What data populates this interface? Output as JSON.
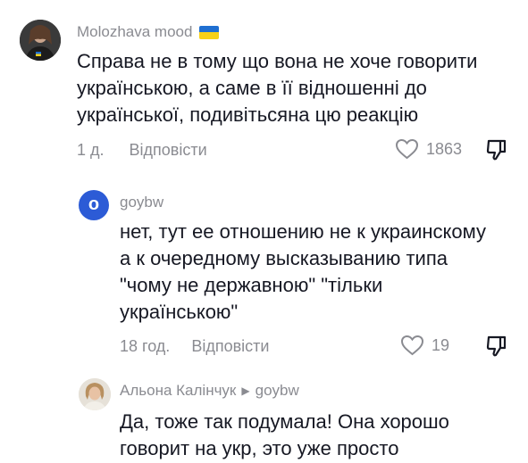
{
  "comments": [
    {
      "username": "Molozhava mood",
      "text": "Справа не в тому що вона не хоче говорити українською, а саме в її відношенні до української, подивітьсяна цю реакцію",
      "time": "1 д.",
      "reply_label": "Відповісти",
      "likes": "1863"
    },
    {
      "username": "goybw",
      "avatar_letter": "o",
      "text": "нет, тут ее отношению не к украинскому а к очередному высказыванию типа \"чому не державною\" \"тільки українською\"",
      "time": "18 год.",
      "reply_label": "Відповісти",
      "likes": "19"
    },
    {
      "username": "Альона Калінчук",
      "reply_to": "goybw",
      "text": "Да, тоже так подумала! Она хорошо говорит на укр, это уже просто"
    }
  ],
  "colors": {
    "muted": "#8a8b91",
    "text": "#161823",
    "avatar_blue": "#2c5bd6"
  },
  "icons": {
    "like": "heart-outline-icon",
    "dislike": "thumbs-down-icon",
    "reply_arrow": "play-triangle-icon",
    "flag": "ukraine-flag-icon"
  }
}
